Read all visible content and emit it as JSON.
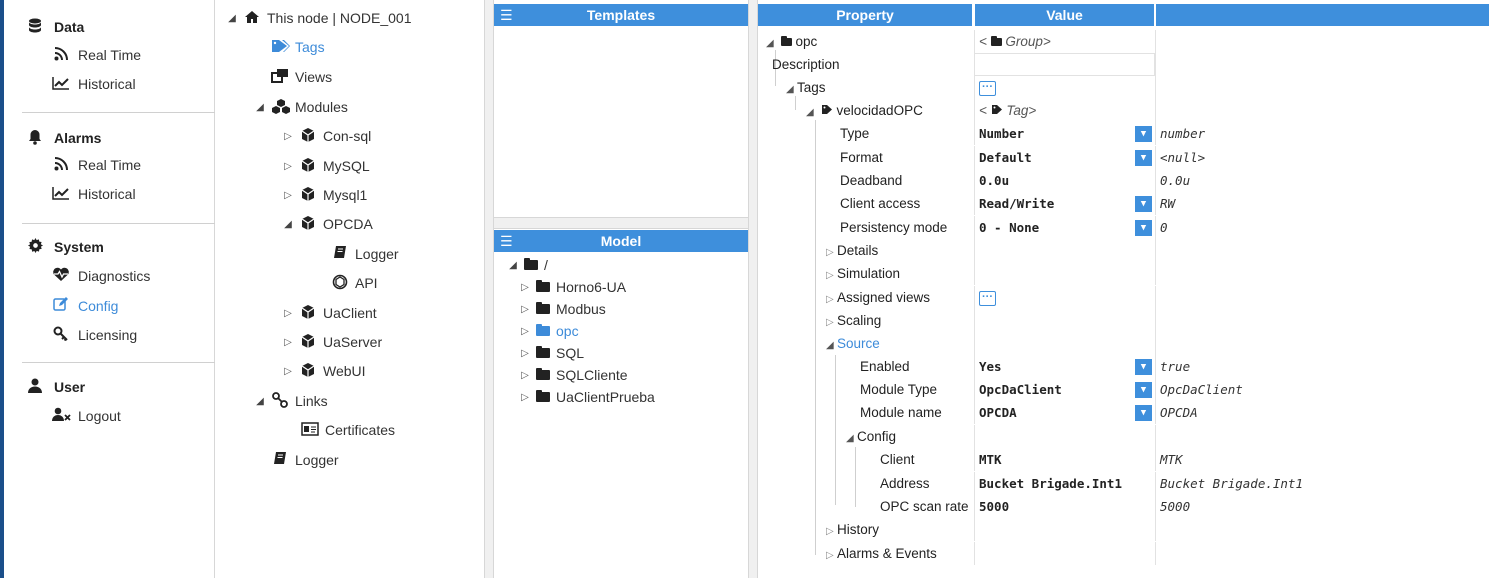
{
  "sidenav": {
    "sections": [
      {
        "title": "Data",
        "icon": "database-icon",
        "items": [
          {
            "label": "Real Time",
            "icon": "rss-icon"
          },
          {
            "label": "Historical",
            "icon": "line-chart-icon"
          }
        ]
      },
      {
        "title": "Alarms",
        "icon": "bell-icon",
        "items": [
          {
            "label": "Real Time",
            "icon": "rss-icon"
          },
          {
            "label": "Historical",
            "icon": "line-chart-icon"
          }
        ]
      },
      {
        "title": "System",
        "icon": "gear-icon",
        "items": [
          {
            "label": "Diagnostics",
            "icon": "heartbeat-icon"
          },
          {
            "label": "Config",
            "icon": "edit-icon",
            "active": true
          },
          {
            "label": "Licensing",
            "icon": "key-icon"
          }
        ]
      },
      {
        "title": "User",
        "icon": "user-icon",
        "items": [
          {
            "label": "Logout",
            "icon": "user-remove-icon"
          }
        ]
      }
    ]
  },
  "tree": {
    "root": "This node | NODE_001",
    "tags": "Tags",
    "views": "Views",
    "modules": "Modules",
    "module_items": [
      "Con-sql",
      "MySQL",
      "Mysql1",
      "OPCDA"
    ],
    "opcda_children": [
      "Logger",
      "API"
    ],
    "module_items_after": [
      "UaClient",
      "UaServer",
      "WebUI"
    ],
    "links": "Links",
    "certificates": "Certificates",
    "logger": "Logger"
  },
  "templates": {
    "title": "Templates"
  },
  "model": {
    "title": "Model",
    "root": "/",
    "items": [
      "Horno6-UA",
      "Modbus",
      "opc",
      "SQL",
      "SQLCliente",
      "UaClientPrueba"
    ],
    "selected": "opc"
  },
  "grid": {
    "header_property": "Property",
    "header_value": "Value",
    "rows": {
      "opc": {
        "name": "opc",
        "value": "< ",
        "value_type": "Group>"
      },
      "description": {
        "name": "Description"
      },
      "tags": {
        "name": "Tags"
      },
      "tag": {
        "name": "velocidadOPC",
        "value": "< ",
        "value_type": "Tag>"
      },
      "type": {
        "name": "Type",
        "value": "Number",
        "raw": "number"
      },
      "format": {
        "name": "Format",
        "value": "Default",
        "raw": "<null>"
      },
      "deadband": {
        "name": "Deadband",
        "value": "0.0u",
        "raw": "0.0u"
      },
      "client_access": {
        "name": "Client access",
        "value": "Read/Write",
        "raw": "RW"
      },
      "persistency": {
        "name": "Persistency mode",
        "value": "0 - None",
        "raw": "0"
      },
      "details": {
        "name": "Details"
      },
      "simulation": {
        "name": "Simulation"
      },
      "assigned_views": {
        "name": "Assigned views"
      },
      "scaling": {
        "name": "Scaling"
      },
      "source": {
        "name": "Source"
      },
      "enabled": {
        "name": "Enabled",
        "value": "Yes",
        "raw": "true"
      },
      "module_type": {
        "name": "Module Type",
        "value": "OpcDaClient",
        "raw": "OpcDaClient"
      },
      "module_name": {
        "name": "Module name",
        "value": "OPCDA",
        "raw": "OPCDA"
      },
      "config": {
        "name": "Config"
      },
      "client": {
        "name": "Client",
        "value": "MTK",
        "raw": "MTK"
      },
      "address": {
        "name": "Address",
        "value": "Bucket Brigade.Int1",
        "raw": "Bucket Brigade.Int1"
      },
      "scan_rate": {
        "name": "OPC scan rate",
        "value": "5000",
        "raw": "5000"
      },
      "history": {
        "name": "History"
      },
      "alarms_events": {
        "name": "Alarms & Events"
      }
    }
  },
  "colors": {
    "accent": "#3e8fdc",
    "sidebar_edge": "#1b4f8a",
    "link": "#3d8bd9"
  }
}
